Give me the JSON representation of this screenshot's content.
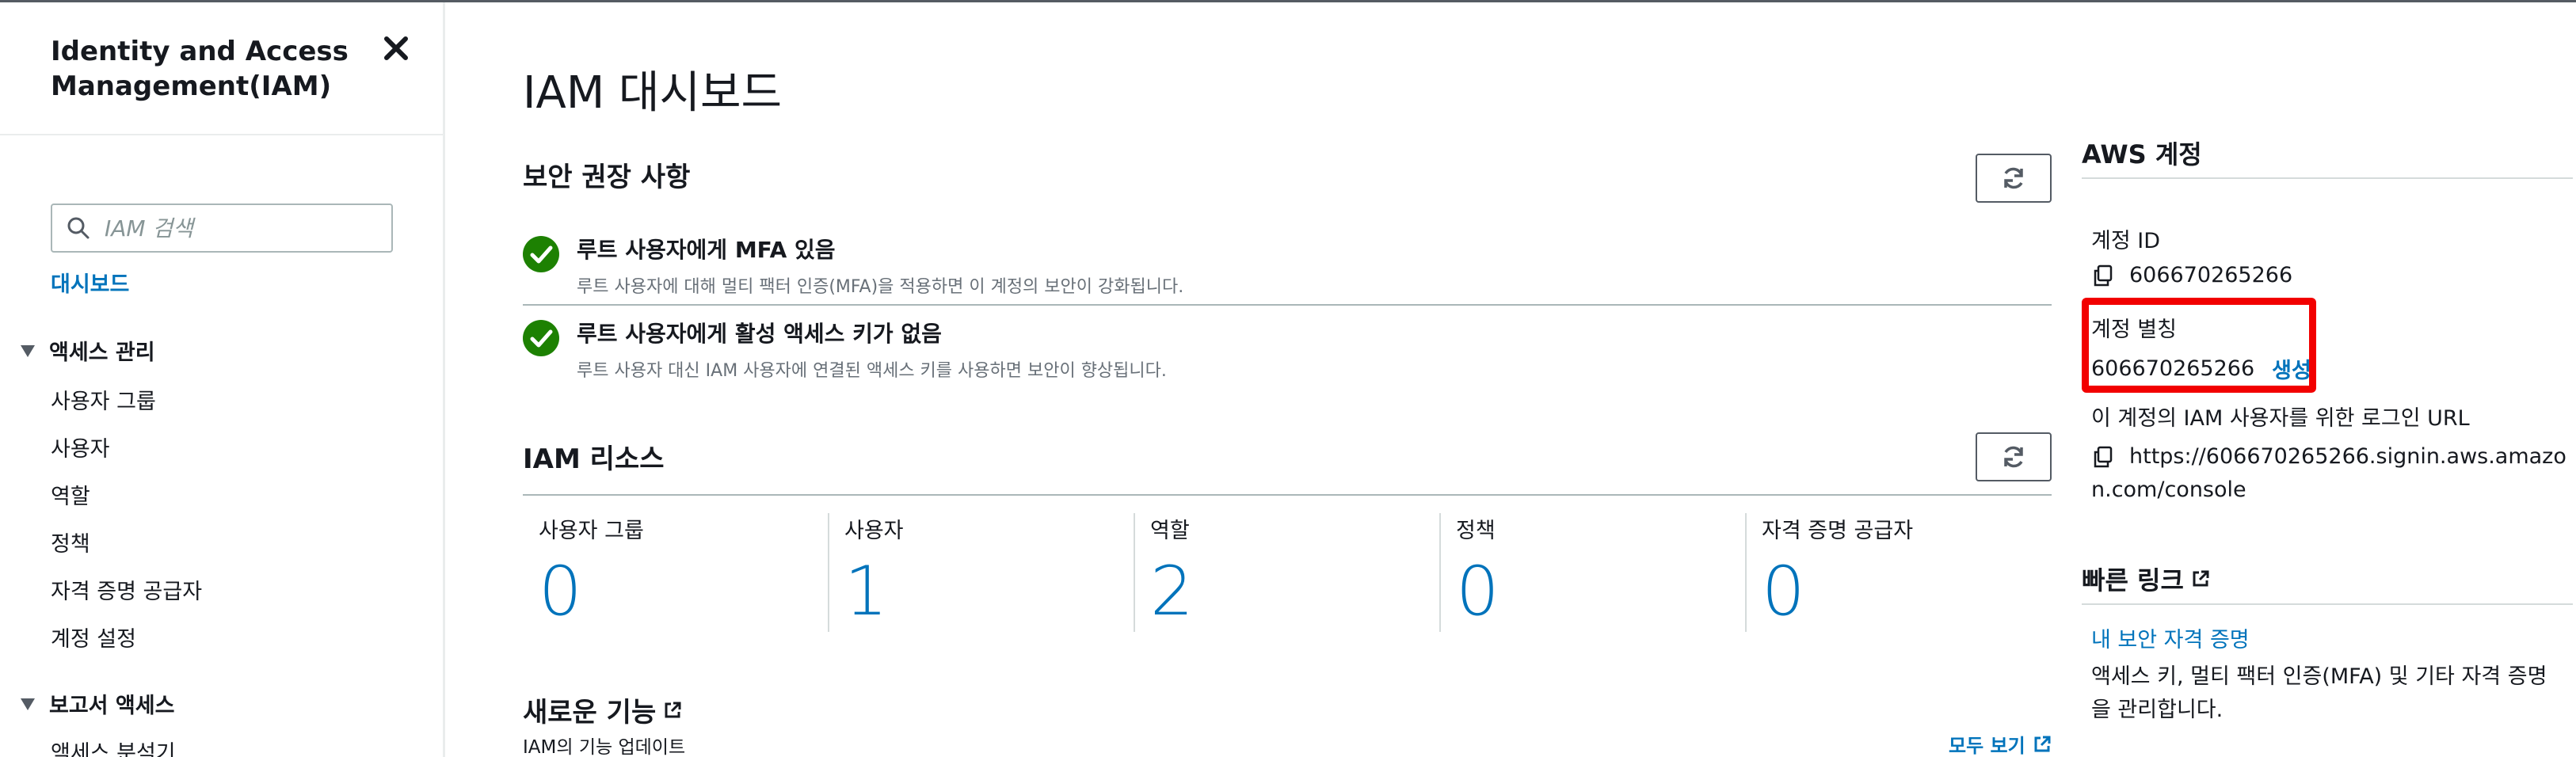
{
  "sidebar": {
    "title": "Identity and Access Management(IAM)",
    "search_placeholder": "IAM 검색",
    "dashboard_link": "대시보드",
    "access_management": {
      "label": "액세스 관리",
      "items": [
        "사용자 그룹",
        "사용자",
        "역할",
        "정책",
        "자격 증명 공급자",
        "계정 설정"
      ]
    },
    "reports": {
      "label": "보고서 액세스",
      "items": [
        "액세스 분석기"
      ]
    }
  },
  "main": {
    "title": "IAM 대시보드",
    "security": {
      "heading": "보안 권장 사항",
      "recommendations": [
        {
          "title": "루트 사용자에게 MFA 있음",
          "desc": "루트 사용자에 대해 멀티 팩터 인증(MFA)을 적용하면 이 계정의 보안이 강화됩니다."
        },
        {
          "title": "루트 사용자에게 활성 액세스 키가 없음",
          "desc": "루트 사용자 대신 IAM 사용자에 연결된 액세스 키를 사용하면 보안이 향상됩니다."
        }
      ]
    },
    "resources": {
      "heading": "IAM 리소스",
      "items": [
        {
          "label": "사용자 그룹",
          "value": "0"
        },
        {
          "label": "사용자",
          "value": "1"
        },
        {
          "label": "역할",
          "value": "2"
        },
        {
          "label": "정책",
          "value": "0"
        },
        {
          "label": "자격 증명 공급자",
          "value": "0"
        }
      ]
    },
    "new_features": {
      "heading": "새로운 기능",
      "subtitle": "IAM의 기능 업데이트",
      "view_all": "모두 보기"
    }
  },
  "account": {
    "heading": "AWS 계정",
    "id_label": "계정 ID",
    "id_value": "606670265266",
    "alias_label": "계정 별칭",
    "alias_value": "606670265266",
    "alias_create": "생성",
    "signin_label": "이 계정의 IAM 사용자를 위한 로그인 URL",
    "signin_url": "https://606670265266.signin.aws.amazon.com/console"
  },
  "quick_links": {
    "heading": "빠른 링크",
    "link": "내 보안 자격 증명",
    "desc": "액세스 키, 멀티 팩터 인증(MFA) 및 기타 자격 증명을 관리합니다."
  },
  "colors": {
    "link_blue": "#0073bb",
    "success_green": "#1d8102",
    "highlight_red": "#f20000"
  }
}
